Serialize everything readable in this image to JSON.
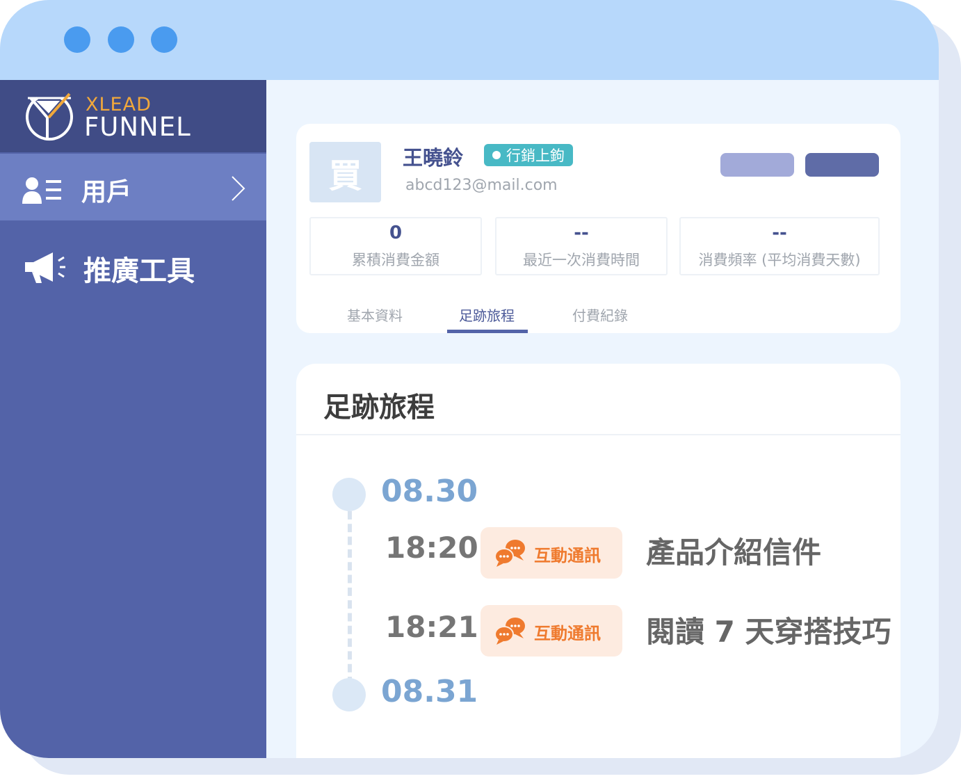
{
  "brand": {
    "logo_top": "XLEAD",
    "logo_bottom": "FUNNEL"
  },
  "sidebar": {
    "items": [
      {
        "label": "用戶",
        "icon": "user-list-icon",
        "active": true
      },
      {
        "label": "推廣工具",
        "icon": "megaphone-icon",
        "active": false
      }
    ]
  },
  "profile": {
    "avatar_text": "買",
    "name": "王曉鈴",
    "tag": "行銷上鉤",
    "email": "abcd123@mail.com",
    "stats": [
      {
        "value": "0",
        "label": "累積消費金額"
      },
      {
        "value": "--",
        "label": "最近一次消費時間"
      },
      {
        "value": "--",
        "label": "消費頻率 (平均消費天數)"
      }
    ],
    "tabs": [
      {
        "label": "基本資料",
        "active": false
      },
      {
        "label": "足跡旅程",
        "active": true
      },
      {
        "label": "付費紀錄",
        "active": false
      }
    ]
  },
  "journey": {
    "title": "足跡旅程",
    "days": [
      {
        "date": "08.30",
        "events": [
          {
            "time": "18:20",
            "badge": "互動通訊",
            "text": "產品介紹信件"
          },
          {
            "time": "18:21",
            "badge": "互動通訊",
            "text": "閱讀 7 天穿搭技巧"
          }
        ]
      },
      {
        "date": "08.31",
        "events": []
      }
    ]
  },
  "colors": {
    "titlebar": "#b7d8fb",
    "window_dots": "#4a9bef",
    "sidebar": "#5363a8",
    "sidebar_active": "#6d7fc3",
    "logo_bg": "#404c86",
    "tag": "#48b9c5",
    "badge_bg": "#fdebe0",
    "badge_text": "#ef7a2e",
    "date_text": "#7ba5d2",
    "button_light": "#a2aad9",
    "button_dark": "#5f6ca7"
  }
}
